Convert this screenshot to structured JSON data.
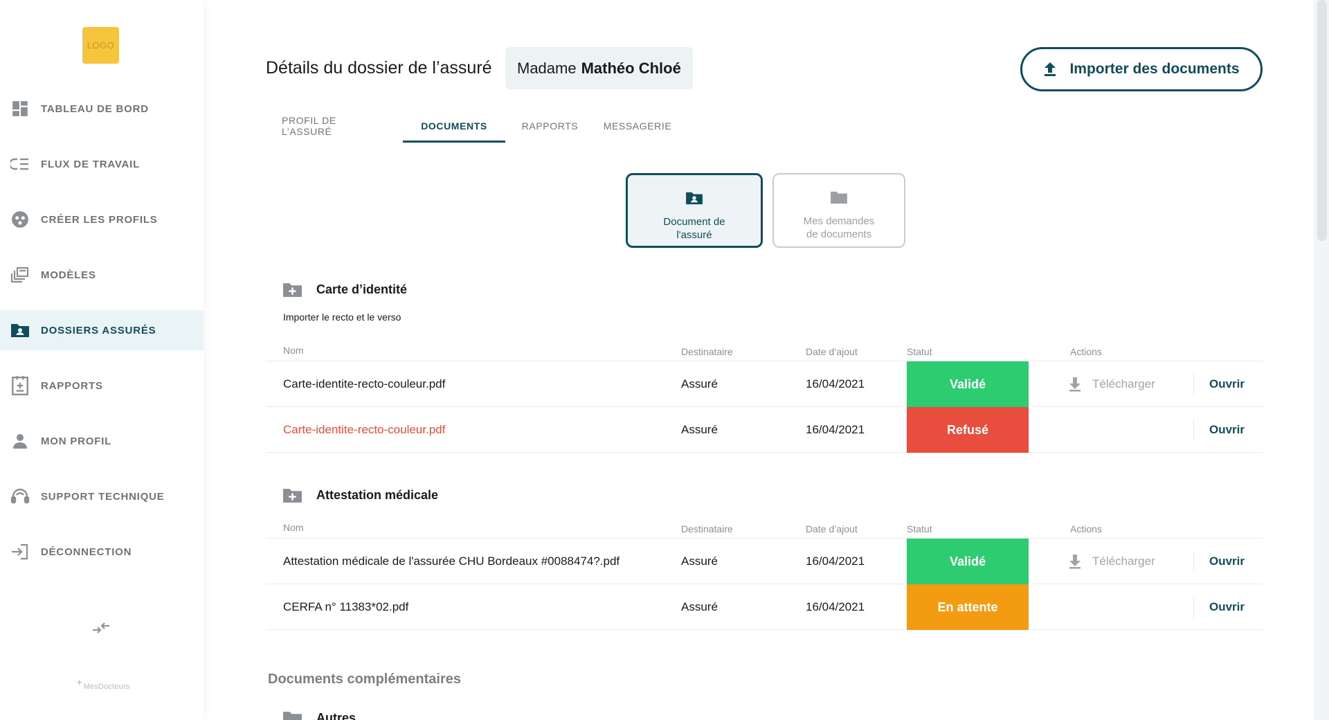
{
  "sidebar": {
    "logo_text": "LOGO",
    "items": [
      {
        "label": "TABLEAU DE BORD",
        "icon": "dashboard-icon",
        "active": false
      },
      {
        "label": "FLUX DE TRAVAIL",
        "icon": "workflow-icon",
        "active": false
      },
      {
        "label": "CRÉER LES PROFILS",
        "icon": "create-profiles-icon",
        "active": false
      },
      {
        "label": "MODÈLES",
        "icon": "templates-icon",
        "active": false
      },
      {
        "label": "DOSSIERS ASSURÉS",
        "icon": "insured-folder-icon",
        "active": true
      },
      {
        "label": "RAPPORTS",
        "icon": "reports-icon",
        "active": false
      },
      {
        "label": "MON PROFIL",
        "icon": "user-icon",
        "active": false
      },
      {
        "label": "SUPPORT TECHNIQUE",
        "icon": "support-headset-icon",
        "active": false
      },
      {
        "label": "DÉCONNECTION",
        "icon": "logout-icon",
        "active": false
      }
    ],
    "collapse_icon": "collapse-arrows-icon",
    "brand_text": "MesDocteurs"
  },
  "header": {
    "title": "Détails du dossier de l’assuré",
    "person_civility": "Madame",
    "person_name": "Mathéo Chloé",
    "import_button": "Importer des documents"
  },
  "tabs": [
    {
      "label": "PROFIL DE L’ASSURÉ",
      "active": false
    },
    {
      "label": "DOCUMENTS",
      "active": true
    },
    {
      "label": "RAPPORTS",
      "active": false
    },
    {
      "label": "MESSAGERIE",
      "active": false
    }
  ],
  "doc_types": {
    "insured": {
      "line1": "Document de",
      "line2": "l'assuré",
      "active": true
    },
    "requests": {
      "line1": "Mes demandes",
      "line2": "de documents",
      "active": false
    }
  },
  "columns": {
    "name": "Nom",
    "recipient": "Destinataire",
    "date": "Date d’ajout",
    "status": "Statut",
    "actions": "Actions"
  },
  "colors": {
    "primary": "#0f4c5c",
    "valid": "#2ecc71",
    "refused": "#e84d3d",
    "pending": "#f39c12"
  },
  "sections": [
    {
      "title": "Carte d’identité",
      "subtitle": "Importer le recto et le verso",
      "rows": [
        {
          "name": "Carte-identite-recto-couleur.pdf",
          "recipient": "Assuré",
          "date": "16/04/2021",
          "status": "Validé",
          "download": "Télécharger",
          "open": "Ouvrir"
        },
        {
          "name": "Carte-identite-recto-couleur.pdf",
          "recipient": "Assuré",
          "date": "16/04/2021",
          "status": "Refusé",
          "download": "",
          "open": "Ouvrir"
        }
      ]
    },
    {
      "title": "Attestation médicale",
      "rows": [
        {
          "name": "Attestation médicale de l'assurée CHU Bordeaux #0088474?.pdf",
          "recipient": "Assuré",
          "date": "16/04/2021",
          "status": "Validé",
          "download": "Télécharger",
          "open": "Ouvrir"
        },
        {
          "name": "CERFA n° 11383*02.pdf",
          "recipient": "Assuré",
          "date": "16/04/2021",
          "status": "En attente",
          "download": "",
          "open": "Ouvrir"
        }
      ]
    }
  ],
  "complementary": {
    "title": "Documents complémentaires",
    "others_title": "Autres"
  }
}
